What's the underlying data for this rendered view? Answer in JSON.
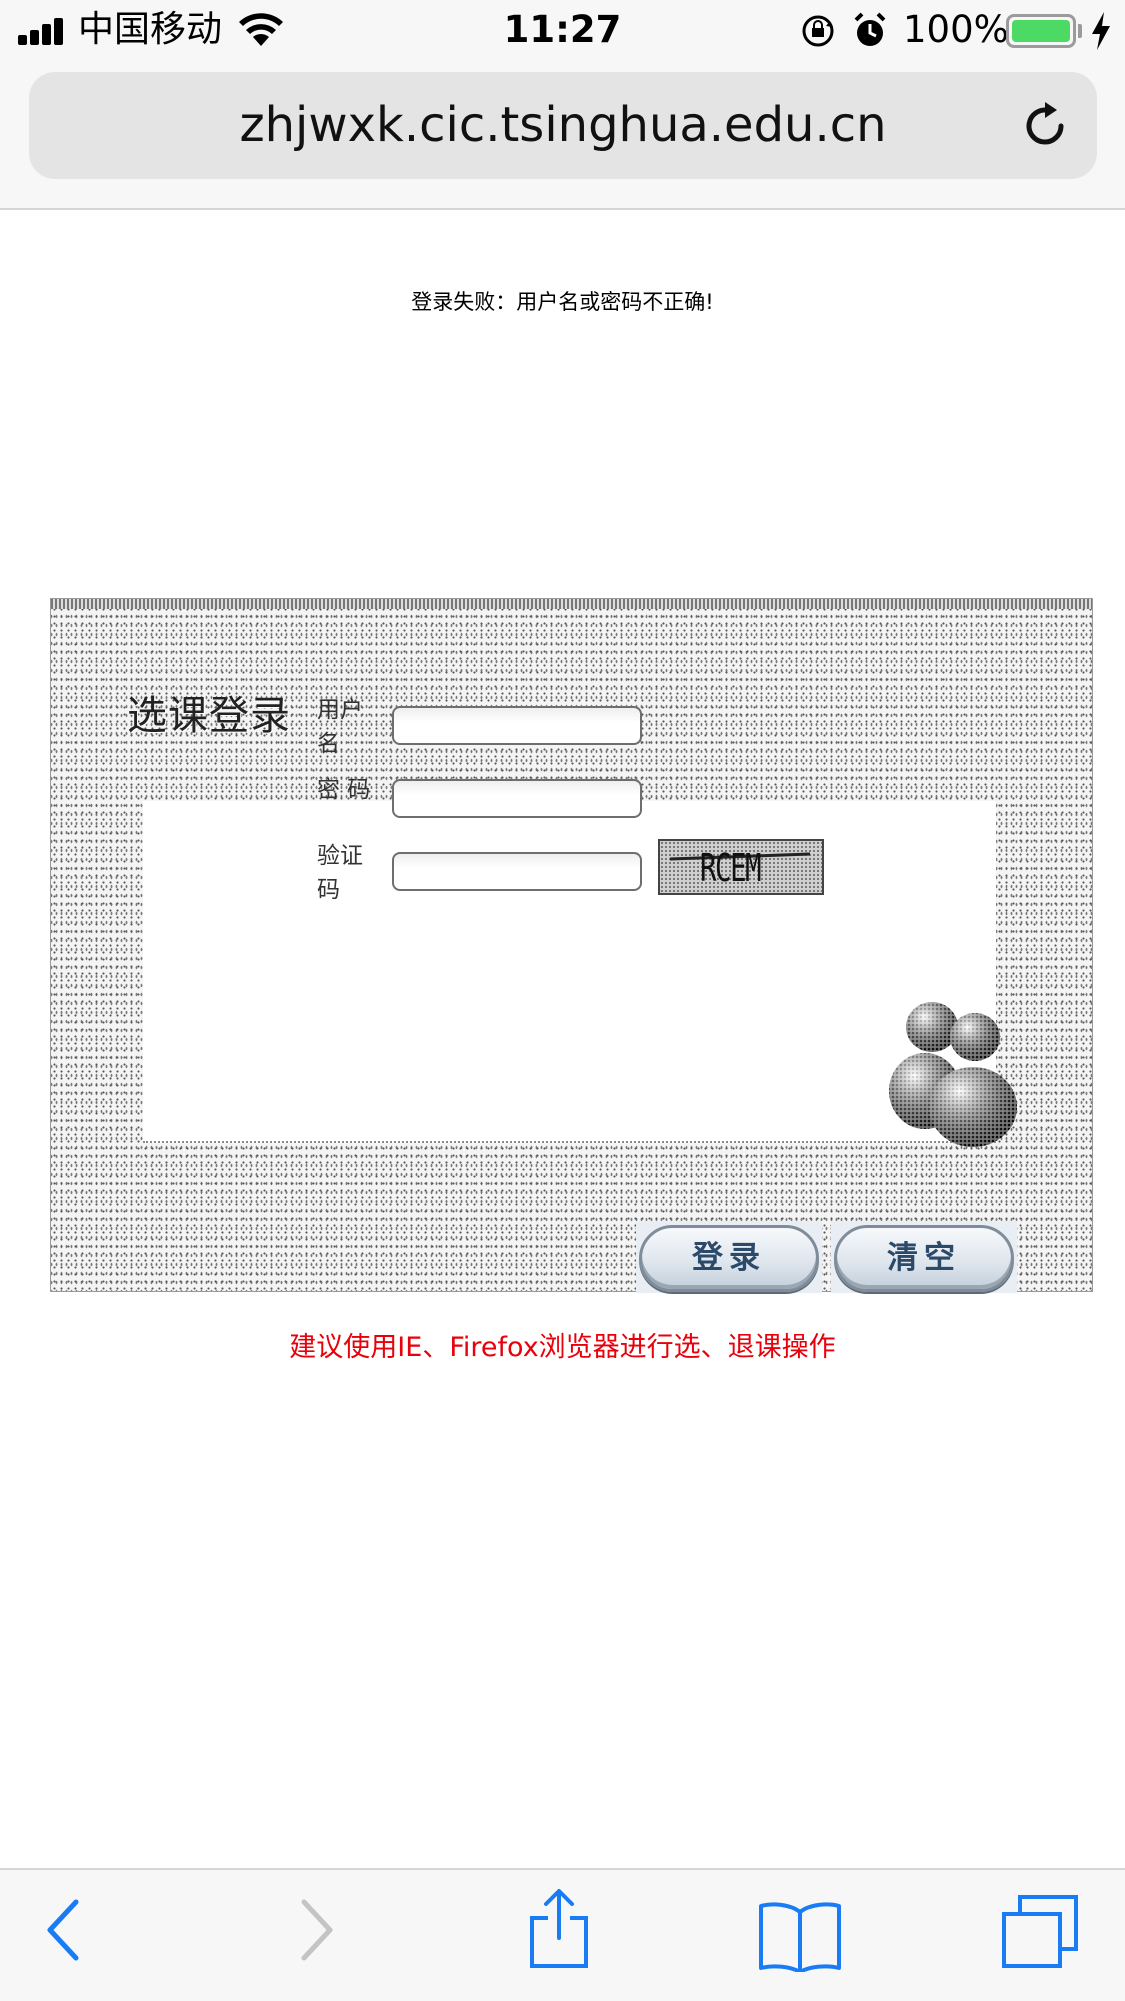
{
  "status_bar": {
    "carrier": "中国移动",
    "time": "11:27",
    "battery_percent": "100%",
    "battery_color": "#4cd964"
  },
  "browser": {
    "url": "zhjwxk.cic.tsinghua.edu.cn",
    "reload_icon": "reload-icon"
  },
  "page": {
    "error_message": "登录失败：用户名或密码不正确!",
    "panel_title": "选课登录",
    "form": {
      "username_label": "用户名",
      "password_label": "密 码",
      "captcha_label": "验证码",
      "username_value": "",
      "password_value": "",
      "captcha_value": "",
      "captcha_image_text": "RCEM"
    },
    "buttons": {
      "login": "登录",
      "clear": "清空"
    },
    "suggestion": "建议使用IE、Firefox浏览器进行选、退课操作",
    "suggestion_color": "#e8000b"
  },
  "toolbar": {
    "items": [
      "back-icon",
      "forward-icon",
      "share-icon",
      "bookmarks-icon",
      "tabs-icon"
    ],
    "accent": "#1a7cf5"
  }
}
